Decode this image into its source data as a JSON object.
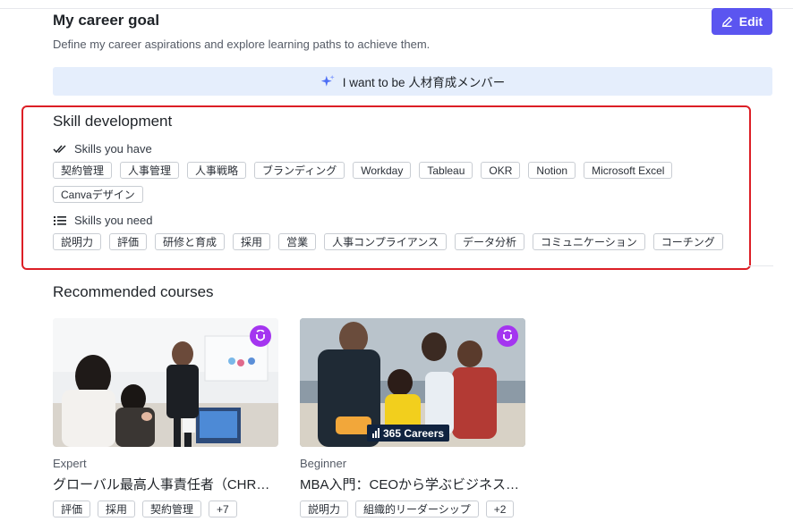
{
  "goal": {
    "title": "My career goal",
    "description": "Define my career aspirations and explore learning paths to achieve them.",
    "edit_label": "Edit",
    "aspiration": "I want to be 人材育成メンバー"
  },
  "skills": {
    "title": "Skill development",
    "have_label": "Skills you have",
    "have": [
      "契約管理",
      "人事管理",
      "人事戦略",
      "ブランディング",
      "Workday",
      "Tableau",
      "OKR",
      "Notion",
      "Microsoft Excel",
      "Canvaデザイン"
    ],
    "need_label": "Skills you need",
    "need": [
      "説明力",
      "評価",
      "研修と育成",
      "採用",
      "営業",
      "人事コンプライアンス",
      "データ分析",
      "コミュニケーション",
      "コーチング"
    ]
  },
  "courses": {
    "title": "Recommended courses",
    "items": [
      {
        "level": "Expert",
        "name": "グローバル最高人事責任者（CHRO）",
        "tags": [
          "評価",
          "採用",
          "契約管理",
          "+7"
        ],
        "brand": ""
      },
      {
        "level": "Beginner",
        "name": "MBA入門：CEOから学ぶビジネススキル",
        "tags": [
          "説明力",
          "組織的リーダーシップ",
          "+2"
        ],
        "brand": "365 Careers"
      }
    ]
  },
  "colors": {
    "accent": "#5b55f0",
    "banner_bg": "#e5eefc",
    "highlight_border": "#dc1f26",
    "provider_badge": "#a435f0"
  }
}
